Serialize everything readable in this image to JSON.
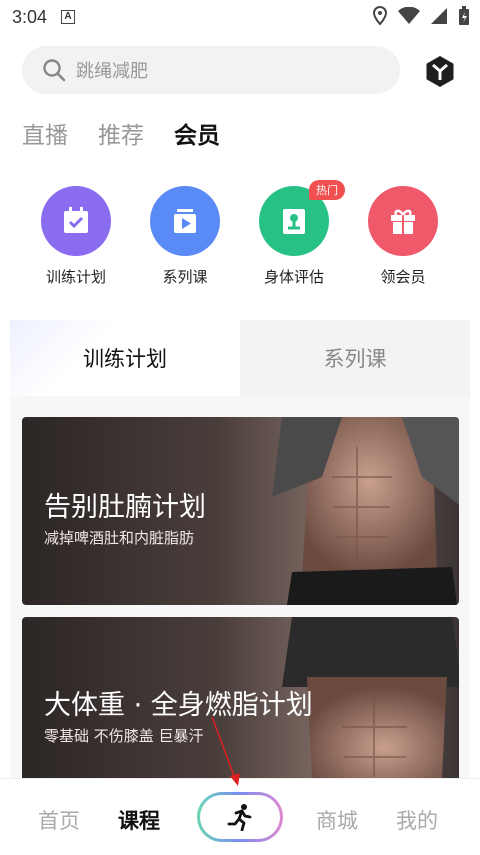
{
  "status_bar": {
    "time": "3:04",
    "badge": "A"
  },
  "search": {
    "placeholder": "跳绳减肥"
  },
  "top_tabs": [
    {
      "label": "直播",
      "active": false
    },
    {
      "label": "推荐",
      "active": false
    },
    {
      "label": "会员",
      "active": true
    }
  ],
  "quick_entries": [
    {
      "label": "训练计划",
      "color": "#8a6cf0",
      "icon": "calendar-check-icon"
    },
    {
      "label": "系列课",
      "color": "#5a8af5",
      "icon": "video-play-icon"
    },
    {
      "label": "身体评估",
      "color": "#28c185",
      "icon": "body-assessment-icon",
      "badge": "热门"
    },
    {
      "label": "领会员",
      "color": "#f0596a",
      "icon": "gift-icon"
    }
  ],
  "plan_tabs": [
    {
      "label": "训练计划",
      "active": true
    },
    {
      "label": "系列课",
      "active": false
    }
  ],
  "cards": [
    {
      "title": "告别肚腩计划",
      "subtitle": "减掉啤酒肚和内脏脂肪"
    },
    {
      "title": "大体重 · 全身燃脂计划",
      "subtitle": "零基础 不伤膝盖 巨暴汗"
    }
  ],
  "bottom_nav": {
    "home": "首页",
    "courses": "课程",
    "mall": "商城",
    "mine": "我的",
    "center_icon": "running-icon"
  },
  "colors": {
    "accent": "#7be0c0",
    "hot": "#f05050"
  }
}
